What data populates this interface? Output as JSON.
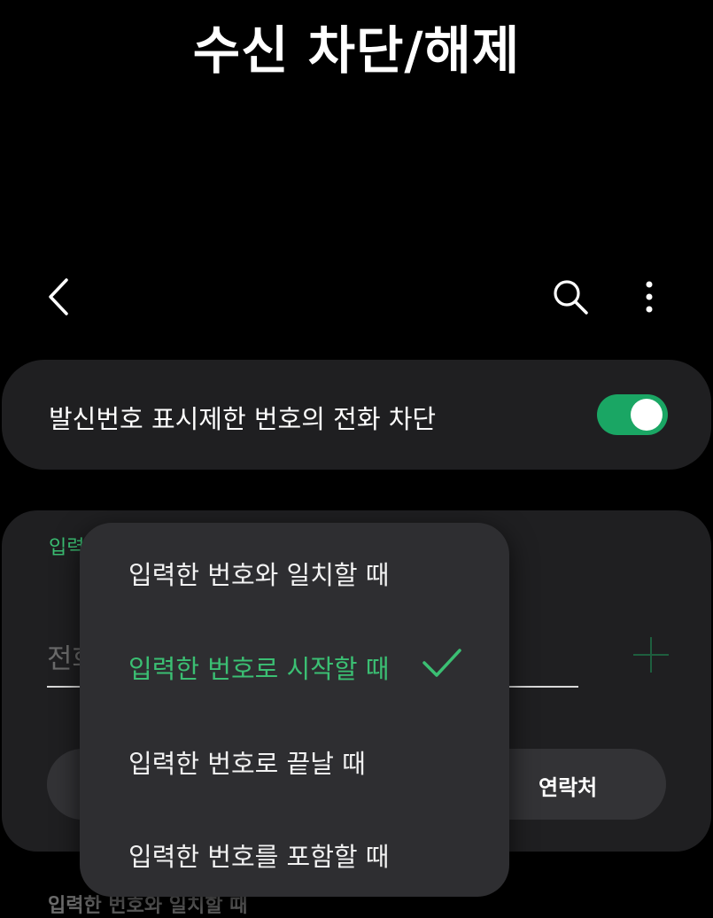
{
  "page_title": "수신 차단/해제",
  "app_bar": {
    "back_icon": "chevron-left-icon",
    "search_icon": "search-icon",
    "more_icon": "more-vertical-icon"
  },
  "block_unknown": {
    "label": "발신번호 표시제한 번호의 전화 차단",
    "enabled": true
  },
  "block_number_form": {
    "condition_label": "입력한 번호로 시작할 때",
    "phone_placeholder": "전화번호",
    "contacts_label": "연락처"
  },
  "dropdown": {
    "items": [
      {
        "label": "입력한 번호와 일치할 때",
        "selected": false
      },
      {
        "label": "입력한 번호로 시작할 때",
        "selected": true
      },
      {
        "label": "입력한 번호로 끝날 때",
        "selected": false
      },
      {
        "label": "입력한 번호를 포함할 때",
        "selected": false
      }
    ]
  },
  "footer_text": "입력한 번호와 일치할 때",
  "colors": {
    "background": "#000000",
    "card": "#1f1f21",
    "menu": "#2e2e31",
    "accent_green": "#3bbf73",
    "switch_on": "#1aa664"
  }
}
